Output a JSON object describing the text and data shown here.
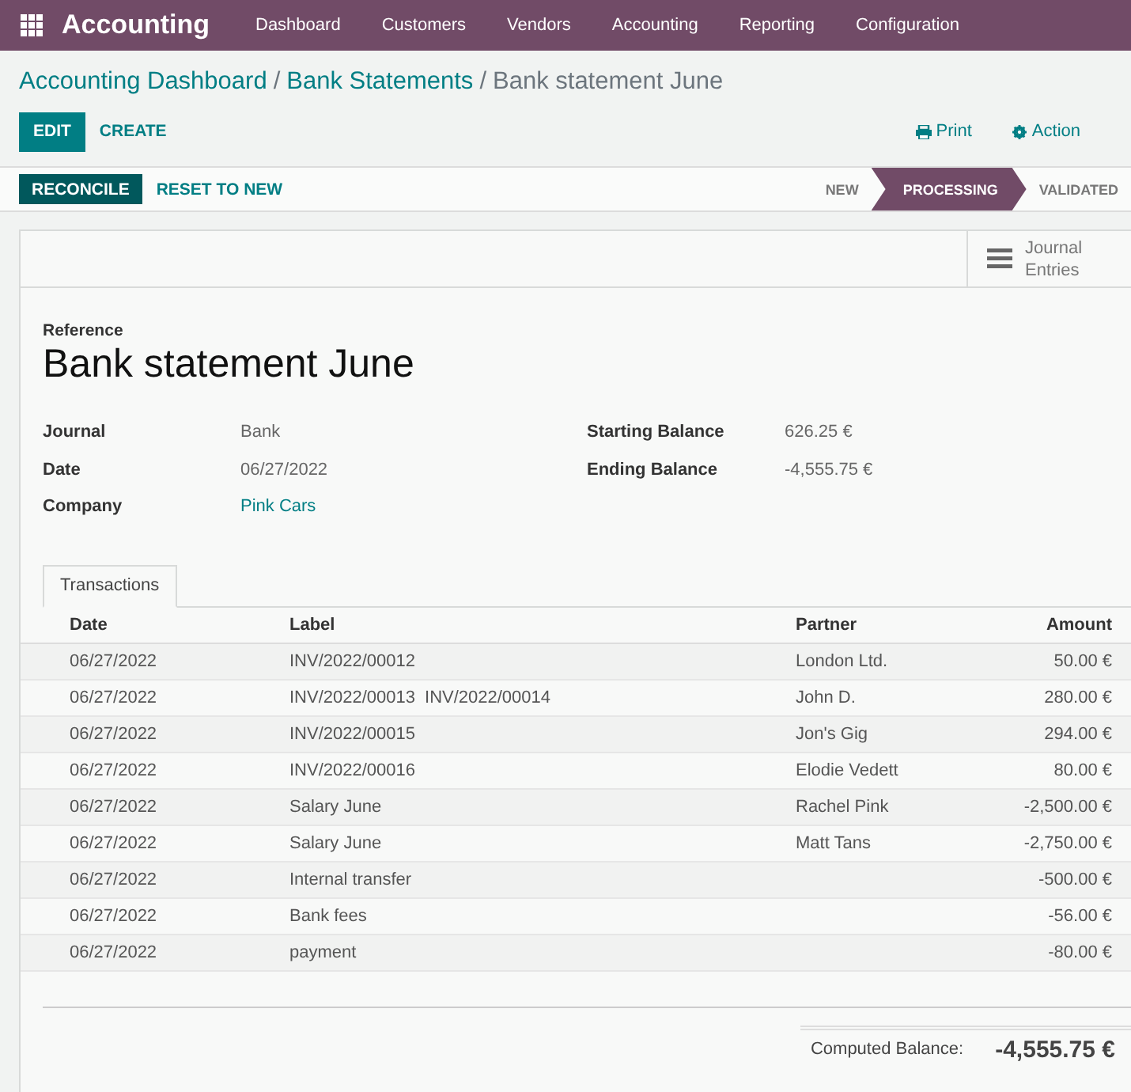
{
  "navbar": {
    "app_title": "Accounting",
    "menu": [
      "Dashboard",
      "Customers",
      "Vendors",
      "Accounting",
      "Reporting",
      "Configuration"
    ]
  },
  "breadcrumb": {
    "links": [
      "Accounting Dashboard",
      "Bank Statements"
    ],
    "separators": [
      "/",
      "/"
    ],
    "current": "Bank statement June"
  },
  "control_buttons": {
    "primary": "EDIT",
    "secondary": "CREATE",
    "print": "Print",
    "action": "Action"
  },
  "header_buttons": {
    "primary": "RECONCILE",
    "secondary": "RESET TO NEW"
  },
  "statusbar": [
    {
      "label": "NEW",
      "selected": false
    },
    {
      "label": "PROCESSING",
      "selected": true
    },
    {
      "label": "VALIDATED",
      "selected": false
    }
  ],
  "smart_button": {
    "label_1": "Journal",
    "label_2": "Entries"
  },
  "reference_label": "Reference",
  "title": "Bank statement June",
  "fields_left": [
    {
      "label": "Journal",
      "value": "Bank",
      "kind": "text"
    },
    {
      "label": "Date",
      "value": "06/27/2022",
      "kind": "text"
    },
    {
      "label": "Company",
      "value": "Pink Cars",
      "kind": "link"
    }
  ],
  "fields_right": [
    {
      "label": "Starting Balance",
      "value": "626.25 €"
    },
    {
      "label": "Ending Balance",
      "value": "-4,555.75 €"
    }
  ],
  "tabs": [
    {
      "label": "Transactions",
      "selected": true
    }
  ],
  "table": {
    "columns": [
      "Date",
      "Label",
      "Partner",
      "Amount"
    ],
    "rows": [
      {
        "date": "06/27/2022",
        "labels": [
          "INV/2022/00012"
        ],
        "partner": "London Ltd.",
        "amount": "50.00 €"
      },
      {
        "date": "06/27/2022",
        "labels": [
          "INV/2022/00013",
          "INV/2022/00014"
        ],
        "partner": "John D.",
        "amount": "280.00 €"
      },
      {
        "date": "06/27/2022",
        "labels": [
          "INV/2022/00015"
        ],
        "partner": "Jon's Gig",
        "amount": "294.00 €"
      },
      {
        "date": "06/27/2022",
        "labels": [
          "INV/2022/00016"
        ],
        "partner": "Elodie Vedett",
        "amount": "80.00 €"
      },
      {
        "date": "06/27/2022",
        "labels": [
          "Salary June"
        ],
        "partner": "Rachel Pink",
        "amount": "-2,500.00 €"
      },
      {
        "date": "06/27/2022",
        "labels": [
          "Salary June"
        ],
        "partner": "Matt Tans",
        "amount": "-2,750.00 €"
      },
      {
        "date": "06/27/2022",
        "labels": [
          "Internal transfer"
        ],
        "amount": "-500.00 €"
      },
      {
        "date": "06/27/2022",
        "labels": [
          "Bank fees"
        ],
        "amount": "-56.00 €"
      },
      {
        "date": "06/27/2022",
        "labels": [
          "payment"
        ],
        "amount": "-80.00 €"
      }
    ]
  },
  "computed_balance": {
    "label": "Computed Balance:",
    "value": "-4,555.75 €"
  }
}
